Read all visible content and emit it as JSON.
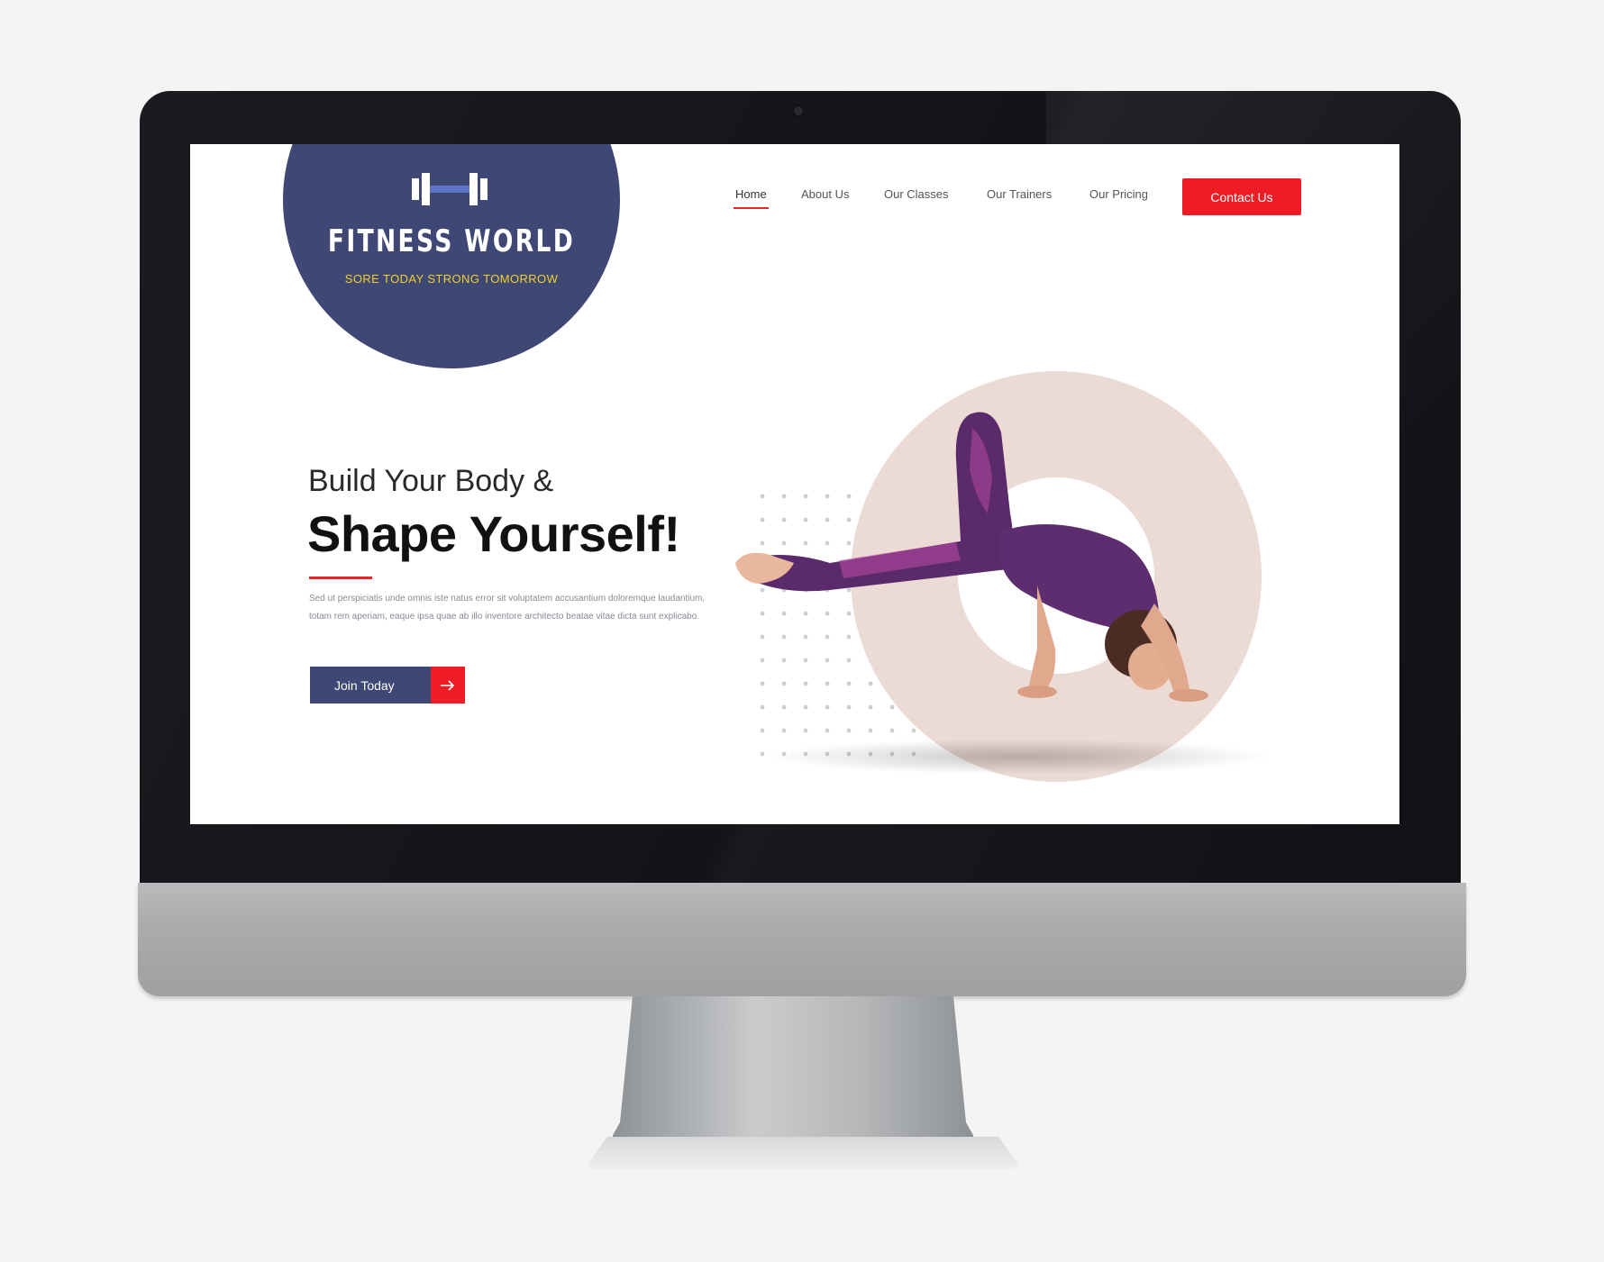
{
  "brand": {
    "name": "FITNESS WORLD",
    "tagline": "SORE TODAY STRONG TOMORROW",
    "icon": "dumbbell-icon"
  },
  "nav": {
    "items": [
      {
        "label": "Home",
        "active": true
      },
      {
        "label": "About Us",
        "active": false
      },
      {
        "label": "Our Classes",
        "active": false
      },
      {
        "label": "Our Trainers",
        "active": false
      },
      {
        "label": "Our Pricing",
        "active": false
      }
    ],
    "cta_label": "Contact Us"
  },
  "hero": {
    "subtitle": "Build Your Body &",
    "title": "Shape Yourself!",
    "body": "Sed ut perspiciatis unde omnis iste natus error sit voluptatem accusantium doloremque laudantium, totam rem aperiam, eaque ipsa quae ab illo inventore  architecto beatae vitae dicta sunt explicabo.",
    "button_label": "Join Today",
    "button_icon": "arrow-right-icon",
    "image": "yoga-pose-photo"
  },
  "colors": {
    "brand_navy": "#3f4874",
    "accent_red": "#ee1c24",
    "tagline_yellow": "#f0d12a",
    "ring_pink": "#ecdad4"
  }
}
